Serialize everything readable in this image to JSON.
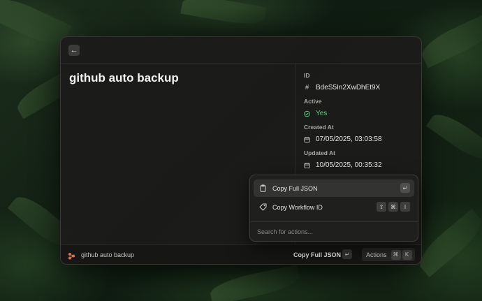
{
  "window": {
    "back_icon": "arrow-left-icon",
    "title": "github auto backup"
  },
  "meta": {
    "id": {
      "label": "ID",
      "value": "BdeS5In2XwDhEt9X",
      "icon": "hash-icon"
    },
    "active": {
      "label": "Active",
      "value": "Yes",
      "icon": "check-circle-icon",
      "color": "#57d07a"
    },
    "created": {
      "label": "Created At",
      "value": "07/05/2025, 03:03:58",
      "icon": "calendar-icon"
    },
    "updated": {
      "label": "Updated At",
      "value": "10/05/2025, 00:35:32",
      "icon": "calendar-icon"
    }
  },
  "actions_menu": {
    "items": [
      {
        "label": "Copy Full JSON",
        "icon": "clipboard-icon",
        "shortcut": [
          "↵"
        ]
      },
      {
        "label": "Copy Workflow ID",
        "icon": "tag-icon",
        "shortcut": [
          "⇧",
          "⌘",
          "I"
        ]
      }
    ],
    "search_placeholder": "Search for actions..."
  },
  "footer": {
    "icon": "n8n-logo-icon",
    "name": "github auto backup",
    "primary_action": "Copy Full JSON",
    "primary_key": "↵",
    "actions_label": "Actions",
    "actions_keys": [
      "⌘",
      "K"
    ]
  }
}
